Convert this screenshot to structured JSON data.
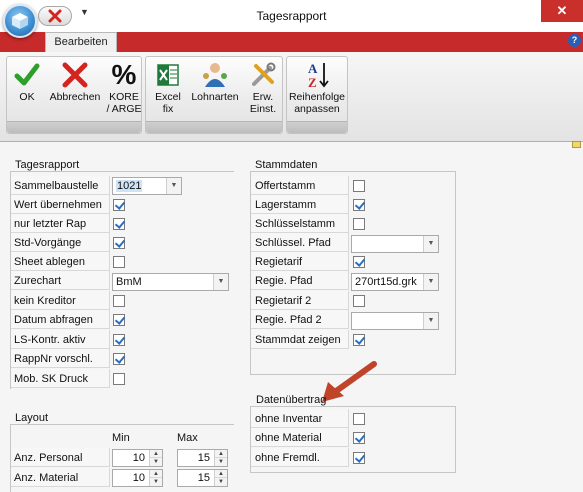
{
  "window": {
    "title": "Tagesrapport",
    "close_label": "✕"
  },
  "ribbon": {
    "tab": "Bearbeiten",
    "help_label": "?",
    "buttons": [
      {
        "label": "OK",
        "icon": "checkmark-icon"
      },
      {
        "label": "Abbrechen",
        "icon": "cross-icon"
      },
      {
        "label": "KORE\n/ ARGE",
        "icon": "percent-icon"
      },
      {
        "label": "Excel\nfix",
        "icon": "excel-icon"
      },
      {
        "label": "Lohnarten",
        "icon": "people-icon"
      },
      {
        "label": "Erw.\nEinst.",
        "icon": "tools-icon"
      },
      {
        "label": "Reihenfolge\nanpassen",
        "icon": "sort-az-icon"
      }
    ]
  },
  "tagesrapport": {
    "heading": "Tagesrapport",
    "sammelbaustelle": {
      "label": "Sammelbaustelle",
      "value": "1021"
    },
    "wert_uebernehmen": {
      "label": "Wert übernehmen",
      "checked": true
    },
    "nur_letzter_rap": {
      "label": "nur letzter Rap",
      "checked": true
    },
    "std_vorgaenge": {
      "label": "Std-Vorgänge",
      "checked": true
    },
    "sheet_ablegen": {
      "label": "Sheet ablegen",
      "checked": false
    },
    "zurechart": {
      "label": "Zurechart",
      "value": "BmM"
    },
    "kein_kreditor": {
      "label": "kein Kreditor",
      "checked": false
    },
    "datum_abfragen": {
      "label": "Datum abfragen",
      "checked": true
    },
    "ls_kontr_aktiv": {
      "label": "LS-Kontr. aktiv",
      "checked": true
    },
    "rappnr_vorschl": {
      "label": "RappNr vorschl.",
      "checked": true
    },
    "mob_sk_druck": {
      "label": "Mob. SK Druck",
      "checked": false
    }
  },
  "layout": {
    "heading": "Layout",
    "col_min": "Min",
    "col_max": "Max",
    "anz_personal": {
      "label": "Anz. Personal",
      "min": "10",
      "max": "15"
    },
    "anz_material": {
      "label": "Anz. Material",
      "min": "10",
      "max": "15"
    }
  },
  "stammdaten": {
    "heading": "Stammdaten",
    "offertstamm": {
      "label": "Offertstamm",
      "checked": false
    },
    "lagerstamm": {
      "label": "Lagerstamm",
      "checked": true
    },
    "schluesselstamm": {
      "label": "Schlüsselstamm",
      "checked": false
    },
    "schluessel_pfad": {
      "label": "Schlüssel. Pfad",
      "value": ""
    },
    "regietarif": {
      "label": "Regietarif",
      "checked": true
    },
    "regie_pfad": {
      "label": "Regie. Pfad",
      "value": "270rt15d.grk"
    },
    "regietarif_2": {
      "label": "Regietarif 2",
      "checked": false
    },
    "regie_pfad_2": {
      "label": "Regie. Pfad 2",
      "value": ""
    },
    "stammdat_zeigen": {
      "label": "Stammdat zeigen",
      "checked": true
    }
  },
  "datenuebertrag": {
    "heading": "Datenübertrag",
    "ohne_inventar": {
      "label": "ohne Inventar",
      "checked": false
    },
    "ohne_material": {
      "label": "ohne Material",
      "checked": true
    },
    "ohne_fremdl": {
      "label": "ohne Fremdl.",
      "checked": true
    }
  },
  "colors": {
    "ribbon_red": "#c62a2a",
    "check_blue": "#2a6fbf",
    "arrow_annotation": "#c0442a"
  }
}
